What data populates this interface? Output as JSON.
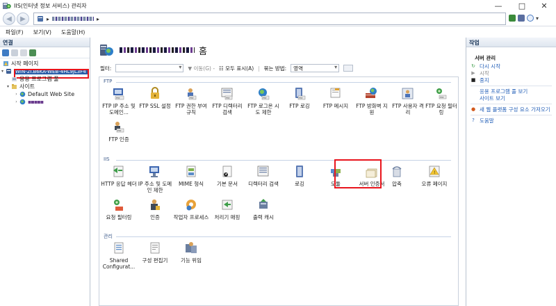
{
  "window": {
    "title": "IIS(인터넷 정보 서비스) 관리자",
    "controls": {
      "minimize": "—",
      "maximize": "□",
      "close": "✕"
    }
  },
  "addressbar": {
    "separator1": "▸",
    "separator2": "▸",
    "dropdown": "▾"
  },
  "menubar": {
    "items": [
      "파일(F)",
      "보기(V)",
      "도움말(H)"
    ]
  },
  "connections": {
    "title": "연결",
    "tree": [
      {
        "label": "시작 페이지",
        "icon": "start-page-icon"
      },
      {
        "label": "WIN-2I.B6KA-WEB-4HL9JL3F4",
        "icon": "server-icon",
        "selected": true
      },
      {
        "label": "응용 프로그램 풀",
        "icon": "app-pool-icon"
      },
      {
        "label": "사이트",
        "icon": "sites-folder-icon"
      },
      {
        "label": "Default Web Site",
        "icon": "globe-icon"
      },
      {
        "label": "▪▪▪▪▪",
        "icon": "globe-icon"
      }
    ]
  },
  "center": {
    "home_suffix": "홈",
    "filter_label": "필터:",
    "go_label": "이동(G)",
    "show_all_label": "모두 표시(A)",
    "group_by_label": "묶는 방법:",
    "group_by_value": "영역",
    "groups": [
      {
        "name": "FTP",
        "features": [
          "FTP IP 주소 및 도메인...",
          "FTP SSL 설정",
          "FTP 권한 부여 규칙",
          "FTP 디렉터리 검색",
          "FTP 로그온 시도 제한",
          "FTP 로깅",
          "FTP 메시지",
          "FTP 방화벽 지원",
          "FTP 사용자 격리",
          "FTP 요청 필터링",
          "FTP 인증"
        ]
      },
      {
        "name": "IIS",
        "features": [
          "HTTP 응답 헤더",
          "IP 주소 및 도메인 제한",
          "MIME 형식",
          "기본 문서",
          "디렉터리 검색",
          "로깅",
          "모듈",
          "서버 인증서",
          "압축",
          "오류 페이지",
          "요청 필터링",
          "인증",
          "작업자 프로세스",
          "처리기 매핑",
          "출력 캐시"
        ]
      },
      {
        "name": "관리",
        "features": [
          "Shared Configurat...",
          "구성 편집기",
          "기능 위임"
        ]
      }
    ]
  },
  "actions": {
    "title": "작업",
    "section_server": "서버 관리",
    "items": [
      {
        "label": "다시 시작",
        "icon": "restart-icon",
        "enabled": true
      },
      {
        "label": "시작",
        "icon": "start-icon",
        "enabled": false
      },
      {
        "label": "중지",
        "icon": "stop-icon",
        "enabled": true
      },
      {
        "label": "응용 프로그램 풀 보기",
        "icon": "",
        "enabled": true
      },
      {
        "label": "사이트 보기",
        "icon": "",
        "enabled": true
      },
      {
        "label": "새 웹 플랫폼 구성 요소 가져오기",
        "icon": "web-platform-icon",
        "enabled": true
      },
      {
        "label": "도움말",
        "icon": "help-icon",
        "enabled": true
      }
    ]
  },
  "colors": {
    "highlight": "#e8141c",
    "link": "#2560b8",
    "group_line": "#c6d3e6"
  }
}
